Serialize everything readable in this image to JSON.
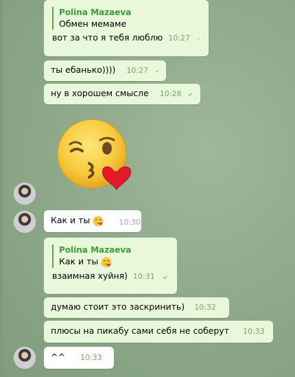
{
  "messages": [
    {
      "id": "m1",
      "type": "outgoing",
      "reply_name": "Polina Mazaeva",
      "reply_text": "Обмен мемаме",
      "text": "вот за что я тебя люблю",
      "time": "10:27"
    },
    {
      "id": "m2",
      "type": "outgoing",
      "text": "ты ебанько))))",
      "time": "10:27"
    },
    {
      "id": "m3",
      "type": "outgoing",
      "text": "ну в хорошем смысле",
      "time": "10:28"
    },
    {
      "id": "m4",
      "type": "incoming-sticker",
      "sticker": "kissing-face-heart-emoji"
    },
    {
      "id": "m5",
      "type": "incoming",
      "text": "Как и ты",
      "emoji": "kissing-heart-emoji",
      "time": "10:30"
    },
    {
      "id": "m6",
      "type": "outgoing",
      "reply_name": "Polina Mazaeva",
      "reply_text": "Как и ты",
      "reply_emoji": "kissing-heart-emoji",
      "text": "взаимная хуйня)",
      "time": "10:31"
    },
    {
      "id": "m7",
      "type": "outgoing",
      "text": "думаю стоит это заскринить)",
      "time": "10:32"
    },
    {
      "id": "m8",
      "type": "outgoing",
      "text": "плюсы на пикабу сами себя не соберут",
      "time": "10:33"
    },
    {
      "id": "m9",
      "type": "incoming",
      "text": "^^",
      "time": "10:33"
    }
  ],
  "colors": {
    "outgoing_bubble": "#e9f8da",
    "incoming_bubble": "#ffffff",
    "accent_green": "#58a54c",
    "time_green": "#6daa62"
  }
}
